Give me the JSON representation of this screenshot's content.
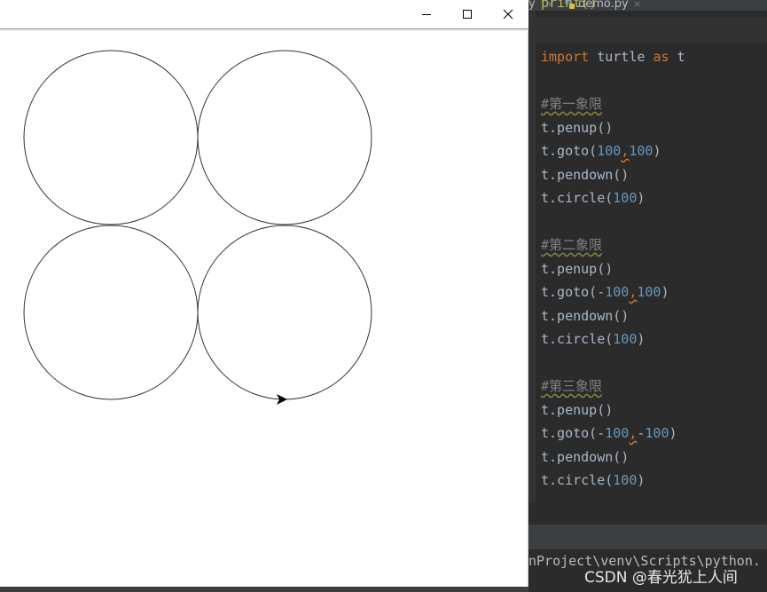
{
  "turtle_window": {
    "controls": {
      "minimize": "minimize",
      "maximize": "maximize",
      "close": "close"
    },
    "drawing": {
      "shapes": [
        "circle",
        "circle",
        "circle",
        "circle"
      ],
      "cursor": "turtle-arrow",
      "stroke_color": "#333333"
    }
  },
  "ide": {
    "tabs": [
      {
        "label": "y",
        "close_glyph": "×"
      },
      {
        "label": "demo.py",
        "close_glyph": "×",
        "icon": "python-file-icon"
      }
    ],
    "code_lines": [
      {
        "parts": [
          [
            "",
            "print()"
          ]
        ]
      },
      {
        "parts": [
          [
            "kw",
            "import"
          ],
          [
            "",
            " turtle "
          ],
          [
            "kw",
            "as"
          ],
          [
            "",
            " t"
          ]
        ]
      },
      {
        "parts": []
      },
      {
        "parts": [
          [
            "cmt",
            "#第一象限"
          ]
        ]
      },
      {
        "parts": [
          [
            "",
            "t.penup()"
          ]
        ]
      },
      {
        "parts": [
          [
            "",
            "t.goto("
          ],
          [
            "num",
            "100"
          ],
          [
            "comma",
            ","
          ],
          [
            "num",
            "100"
          ],
          [
            "",
            ")"
          ]
        ]
      },
      {
        "parts": [
          [
            "",
            "t.pendown()"
          ]
        ]
      },
      {
        "parts": [
          [
            "",
            "t.circle("
          ],
          [
            "num",
            "100"
          ],
          [
            "",
            ")"
          ]
        ]
      },
      {
        "parts": []
      },
      {
        "parts": [
          [
            "cmt",
            "#第二象限"
          ]
        ]
      },
      {
        "parts": [
          [
            "",
            "t.penup()"
          ]
        ]
      },
      {
        "parts": [
          [
            "",
            "t.goto(-"
          ],
          [
            "num",
            "100"
          ],
          [
            "comma",
            ","
          ],
          [
            "num",
            "100"
          ],
          [
            "",
            ")"
          ]
        ]
      },
      {
        "parts": [
          [
            "",
            "t.pendown()"
          ]
        ]
      },
      {
        "parts": [
          [
            "",
            "t.circle("
          ],
          [
            "num",
            "100"
          ],
          [
            "",
            ")"
          ]
        ]
      },
      {
        "parts": []
      },
      {
        "parts": [
          [
            "cmt",
            "#第三象限"
          ]
        ]
      },
      {
        "parts": [
          [
            "",
            "t.penup()"
          ]
        ]
      },
      {
        "parts": [
          [
            "",
            "t.goto(-"
          ],
          [
            "num",
            "100"
          ],
          [
            "comma",
            ","
          ],
          [
            "",
            "-"
          ],
          [
            "num",
            "100"
          ],
          [
            "",
            ")"
          ]
        ]
      },
      {
        "parts": [
          [
            "",
            "t.pendown()"
          ]
        ]
      },
      {
        "parts": [
          [
            "",
            "t.circle("
          ],
          [
            "num",
            "100"
          ],
          [
            "",
            ")"
          ]
        ]
      }
    ],
    "terminal_line": "nProject\\venv\\Scripts\\python."
  },
  "watermark": "CSDN @春光犹上人间",
  "colors": {
    "keyword": "#cc7832",
    "number": "#6897bb",
    "comment": "#808080",
    "text": "#a9b7c6",
    "editor_bg": "#2b2b2b"
  }
}
